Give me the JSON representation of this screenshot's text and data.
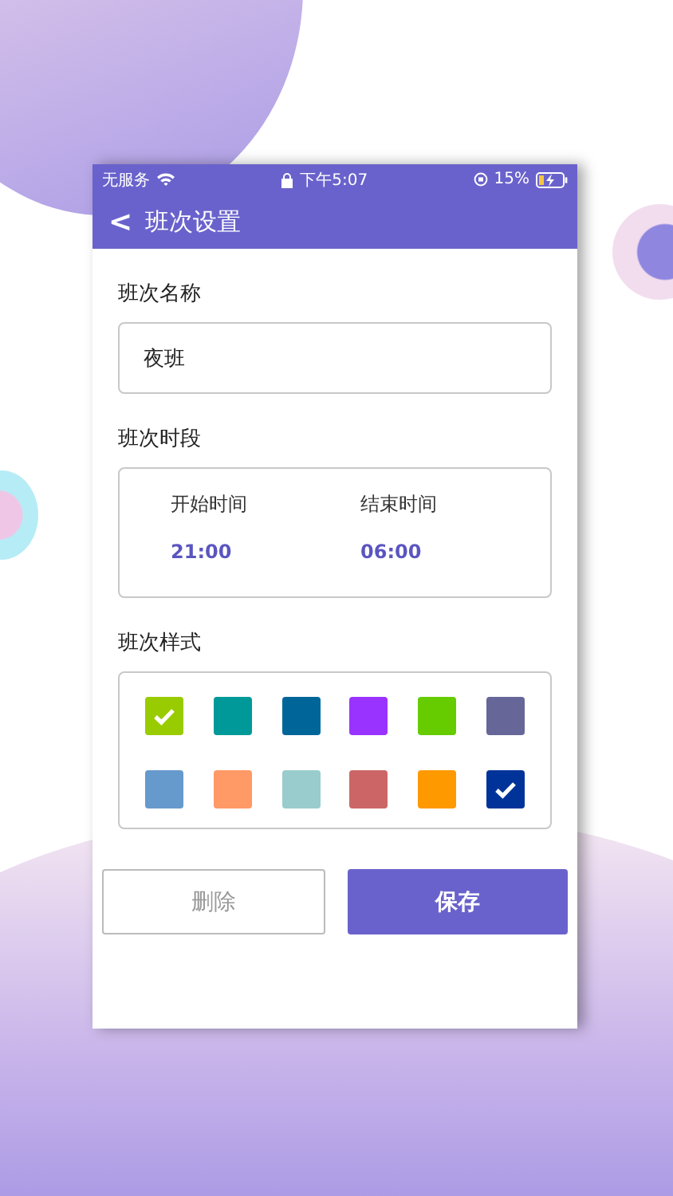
{
  "status_bar": {
    "carrier": "无服务",
    "time": "下午5:07",
    "battery": "15%"
  },
  "nav": {
    "back": "<",
    "title": "班次设置"
  },
  "name_section": {
    "label": "班次名称",
    "value": "夜班"
  },
  "period_section": {
    "label": "班次时段",
    "start_label": "开始时间",
    "start": "21:00",
    "end_label": "结束时间",
    "end": "06:00"
  },
  "style_section": {
    "label": "班次样式",
    "swatches": [
      {
        "color": "#99cc00",
        "selected": true
      },
      {
        "color": "#009999",
        "selected": false
      },
      {
        "color": "#006699",
        "selected": false
      },
      {
        "color": "#9933ff",
        "selected": false
      },
      {
        "color": "#66cc00",
        "selected": false
      },
      {
        "color": "#666699",
        "selected": false
      },
      {
        "color": "#6699cc",
        "selected": false
      },
      {
        "color": "#ff9966",
        "selected": false
      },
      {
        "color": "#99cccc",
        "selected": false
      },
      {
        "color": "#cc6666",
        "selected": false
      },
      {
        "color": "#ff9900",
        "selected": false
      },
      {
        "color": "#003399",
        "selected": true
      }
    ]
  },
  "buttons": {
    "delete": "删除",
    "save": "保存"
  }
}
